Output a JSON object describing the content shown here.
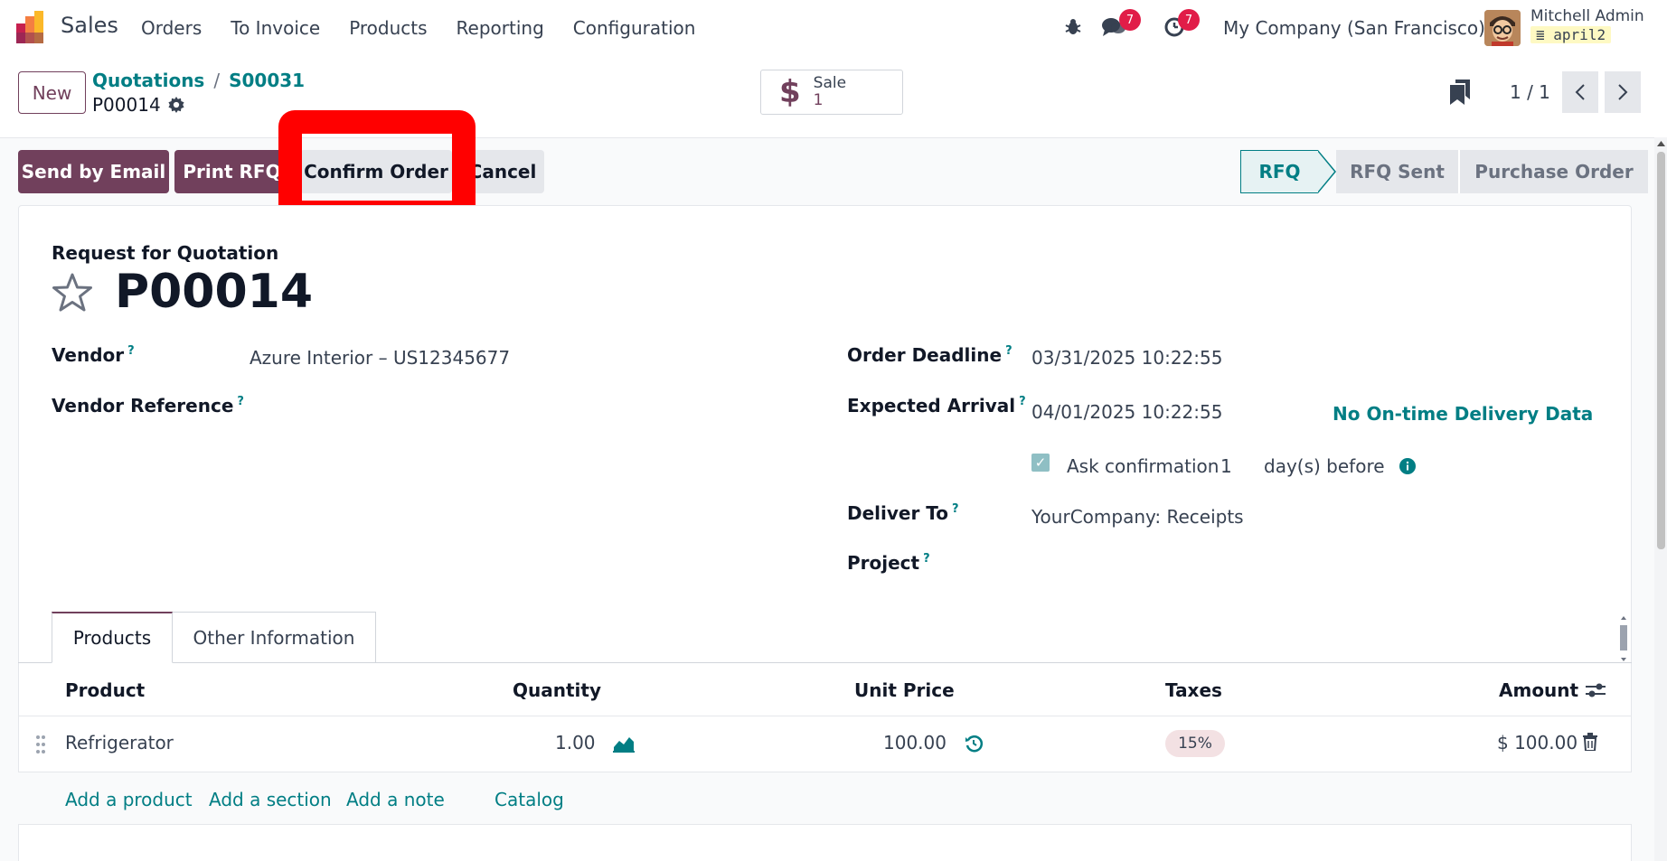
{
  "app": {
    "name": "Sales"
  },
  "nav": {
    "items": [
      "Orders",
      "To Invoice",
      "Products",
      "Reporting",
      "Configuration"
    ]
  },
  "systray": {
    "messages_count": "7",
    "activities_count": "7",
    "company": "My Company (San Francisco)",
    "user_name": "Mitchell Admin",
    "database": "april2"
  },
  "control_panel": {
    "new_label": "New",
    "breadcrumb": [
      "Quotations",
      "S00031"
    ],
    "breadcrumb_sep": "/",
    "record_name": "P00014",
    "smart_button": {
      "label": "Sale",
      "value": "1"
    },
    "pager": "1 / 1"
  },
  "actions": {
    "send_email": "Send by Email",
    "print_rfq": "Print RFQ",
    "confirm_order": "Confirm Order",
    "cancel": "Cancel"
  },
  "status": {
    "stages": [
      "RFQ",
      "RFQ Sent",
      "Purchase Order"
    ],
    "active": "RFQ"
  },
  "form": {
    "title": "Request for Quotation",
    "name": "P00014",
    "vendor_label": "Vendor",
    "vendor_value": "Azure Interior – US12345677",
    "vendor_ref_label": "Vendor Reference",
    "order_deadline_label": "Order Deadline",
    "order_deadline_value": "03/31/2025 10:22:55",
    "expected_arrival_label": "Expected Arrival",
    "expected_arrival_value": "04/01/2025 10:22:55",
    "otd_link": "No On-time Delivery Data",
    "ask_confirmation_label": "Ask confirmation",
    "ask_confirmation_days": "1",
    "days_before": "day(s) before",
    "deliver_to_label": "Deliver To",
    "deliver_to_value": "YourCompany: Receipts",
    "project_label": "Project",
    "help_mark": "?"
  },
  "tabs": [
    "Products",
    "Other Information"
  ],
  "table": {
    "headers": {
      "product": "Product",
      "quantity": "Quantity",
      "unit_price": "Unit Price",
      "taxes": "Taxes",
      "amount": "Amount"
    },
    "rows": [
      {
        "product": "Refrigerator",
        "quantity": "1.00",
        "unit_price": "100.00",
        "taxes": "15%",
        "amount": "$ 100.00"
      }
    ],
    "add_links": [
      "Add a product",
      "Add a section",
      "Add a note",
      "Catalog"
    ]
  },
  "colors": {
    "brand": "#71405c",
    "accent": "#017e84",
    "highlight": "#ff0000",
    "badge": "#e11d48"
  }
}
